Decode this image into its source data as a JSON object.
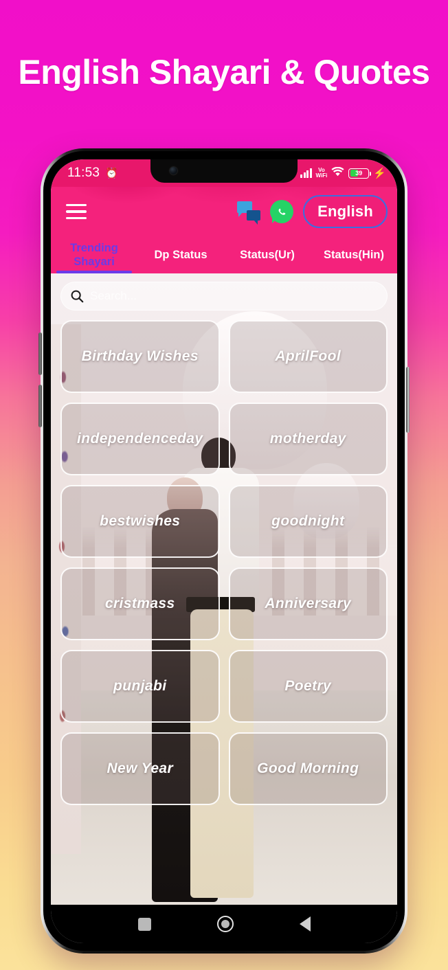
{
  "promo": {
    "title": "English Shayari & Quotes"
  },
  "phone": {
    "status_bar": {
      "time": "11:53",
      "emoji_icon": "alarm-emoji-icon",
      "signal_icon": "cellular-signal-icon",
      "vowifi_line1": "Vo",
      "vowifi_line2": "WiFi",
      "wifi_icon": "wifi-icon",
      "battery_percent": "39",
      "charging_icon": "charging-bolt-icon",
      "battery_fill_color": "#2FD24B"
    },
    "app_bar": {
      "menu_icon": "hamburger-menu-icon",
      "chat_icon": "messenger-chat-icon",
      "whatsapp_icon": "whatsapp-icon",
      "language_button": "English",
      "background_color": "#F4227C",
      "pill_border_color": "#3A6FE0"
    },
    "tabs": {
      "active_color": "#6B3BE8",
      "items": [
        {
          "label": "Trending Shayari",
          "active": true
        },
        {
          "label": "Dp Status",
          "active": false
        },
        {
          "label": "Status(Ur)",
          "active": false
        },
        {
          "label": "Status(Hin)",
          "active": false
        }
      ]
    },
    "search": {
      "icon": "search-icon",
      "value": "",
      "placeholder": "Search..."
    },
    "categories": [
      {
        "label": "Birthday Wishes"
      },
      {
        "label": "AprilFool"
      },
      {
        "label": "independenceday"
      },
      {
        "label": "motherday"
      },
      {
        "label": "bestwishes"
      },
      {
        "label": "goodnight"
      },
      {
        "label": "cristmass"
      },
      {
        "label": "Anniversary"
      },
      {
        "label": "punjabi"
      },
      {
        "label": "Poetry"
      },
      {
        "label": "New Year"
      },
      {
        "label": "Good Morning"
      }
    ],
    "nav_bar": {
      "recents_icon": "square-recents-icon",
      "home_icon": "circle-home-icon",
      "back_icon": "triangle-back-icon"
    }
  },
  "theme": {
    "background_top": "#F10FC9",
    "background_bottom": "#FBE29B",
    "accent_pink": "#F4227C",
    "status_bar_pink": "#E8176B"
  }
}
